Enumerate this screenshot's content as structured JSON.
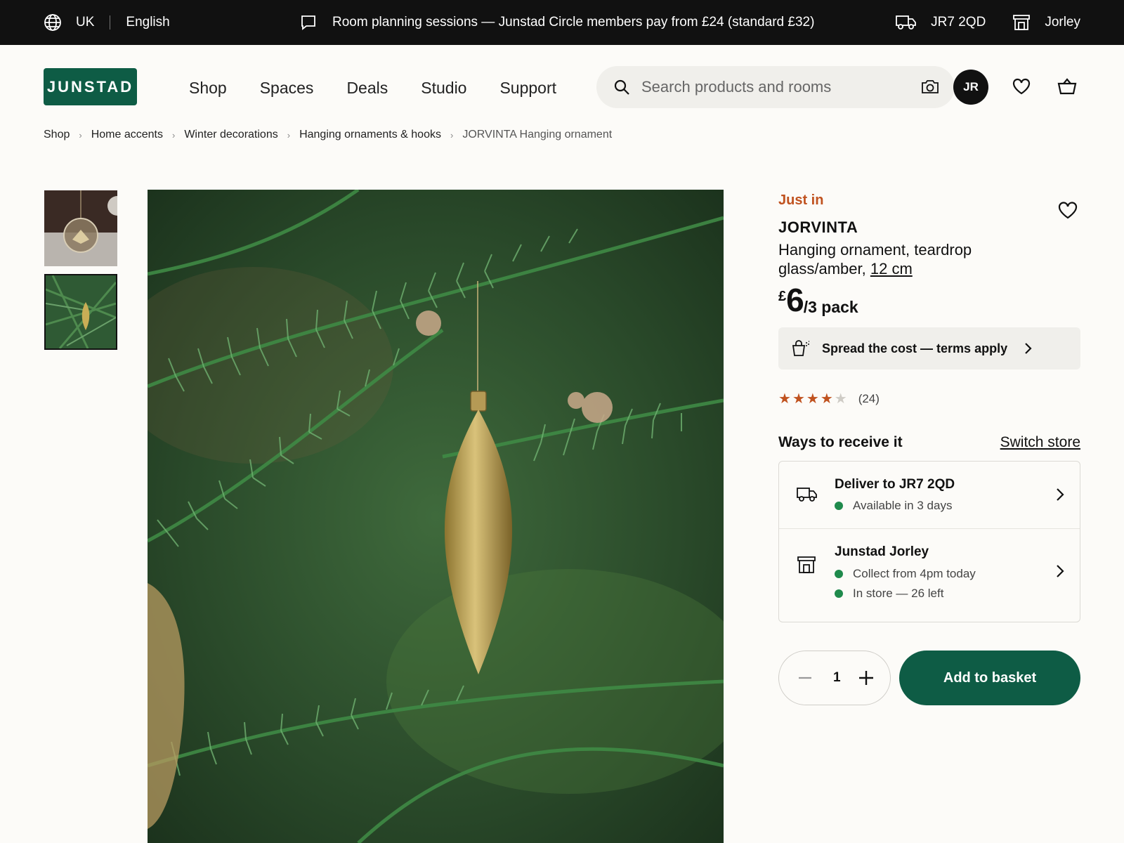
{
  "topbar": {
    "country": "UK",
    "language": "English",
    "promo": "Room planning sessions — Junstad Circle members pay from £24 (standard £32)",
    "postcode": "JR7 2QD",
    "store": "Jorley"
  },
  "header": {
    "logo": "JUNSTAD",
    "nav": [
      "Shop",
      "Spaces",
      "Deals",
      "Studio",
      "Support"
    ],
    "search_placeholder": "Search products and rooms",
    "avatar_initials": "JR"
  },
  "breadcrumb": [
    "Shop",
    "Home accents",
    "Winter decorations",
    "Hanging ornaments & hooks",
    "JORVINTA Hanging ornament"
  ],
  "product": {
    "badge": "Just in",
    "name": "JORVINTA",
    "desc_prefix": "Hanging ornament, teardrop glass/amber,",
    "size": "12 cm",
    "price_currency": "£",
    "price_value": "6",
    "price_unit": "/3 pack",
    "finance_text": "Spread the cost — terms apply",
    "rating": 4,
    "rating_max": 5,
    "review_count": "(24)"
  },
  "delivery": {
    "heading": "Ways to receive it",
    "switch_label": "Switch store",
    "deliver_title": "Deliver to JR7 2QD",
    "deliver_status": "Available in 3 days",
    "store_title": "Junstad Jorley",
    "collect_status": "Collect from 4pm today",
    "stock_status": "In store — 26 left"
  },
  "purchase": {
    "quantity": "1",
    "add_label": "Add to basket"
  },
  "colors": {
    "brand": "#0e5c45",
    "accent": "#c0521f",
    "status_ok": "#1f8a4c"
  }
}
